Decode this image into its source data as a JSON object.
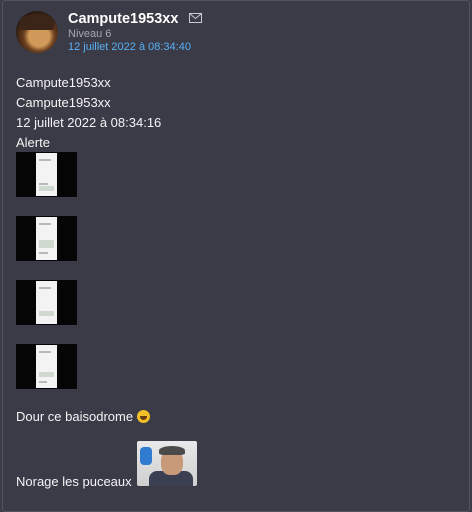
{
  "post": {
    "author": "Campute1953xx",
    "level": "Niveau 6",
    "date": "12 juillet 2022 à 08:34:40"
  },
  "content": {
    "line1": "Campute1953xx",
    "line2": "Campute1953xx",
    "line3": "12 juillet 2022 à 08:34:16",
    "line4": "Alerte",
    "line5": "Dour ce baisodrome",
    "line6": "Norage les puceaux"
  },
  "icons": {
    "mail": "mail-icon",
    "emoji": "grimacing-face-emoji-icon"
  },
  "colors": {
    "background": "#3a3b47",
    "link": "#58b0f3",
    "muted": "#a4a6b3"
  }
}
